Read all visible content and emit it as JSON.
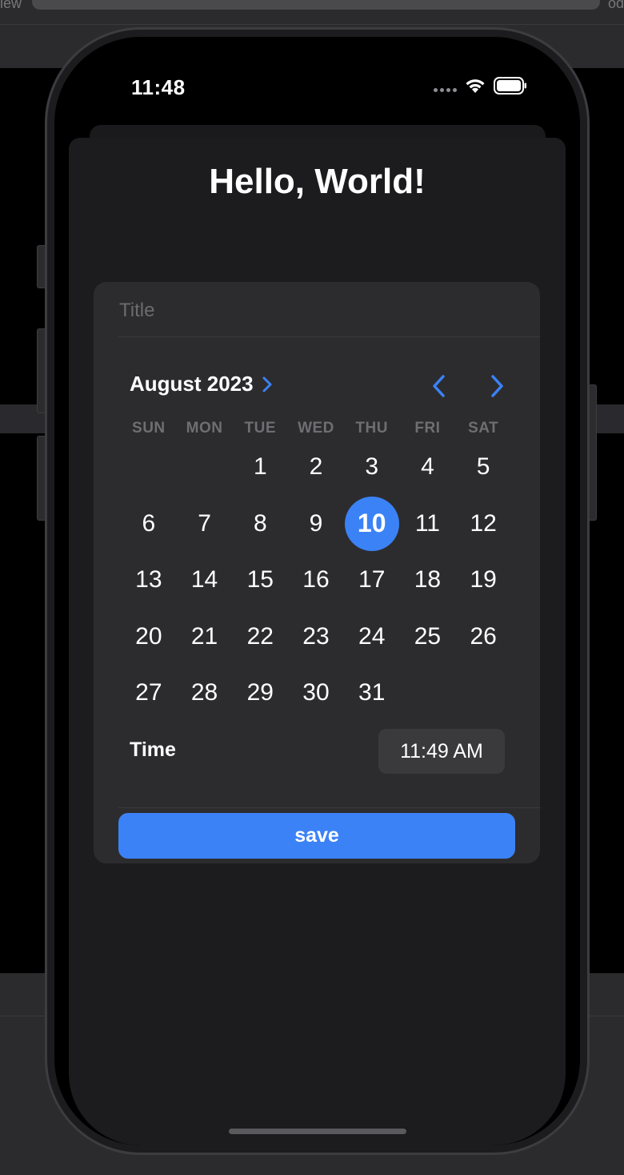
{
  "background": {
    "left_word": "iew",
    "right_word": "od"
  },
  "status_bar": {
    "time": "11:48"
  },
  "page": {
    "heading": "Hello, World!"
  },
  "form": {
    "title_placeholder": "Title",
    "calendar": {
      "month_label": "August 2023",
      "weekdays": [
        "SUN",
        "MON",
        "TUE",
        "WED",
        "THU",
        "FRI",
        "SAT"
      ],
      "selected_day": "10",
      "days": [
        "",
        "",
        "1",
        "2",
        "3",
        "4",
        "5",
        "6",
        "7",
        "8",
        "9",
        "10",
        "11",
        "12",
        "13",
        "14",
        "15",
        "16",
        "17",
        "18",
        "19",
        "20",
        "21",
        "22",
        "23",
        "24",
        "25",
        "26",
        "27",
        "28",
        "29",
        "30",
        "31",
        "",
        ""
      ]
    },
    "time_label": "Time",
    "time_value": "11:49 AM",
    "save_label": "save"
  },
  "colors": {
    "accent": "#3b82f6",
    "card": "#2c2c2e",
    "sheet": "#1c1c1e"
  }
}
